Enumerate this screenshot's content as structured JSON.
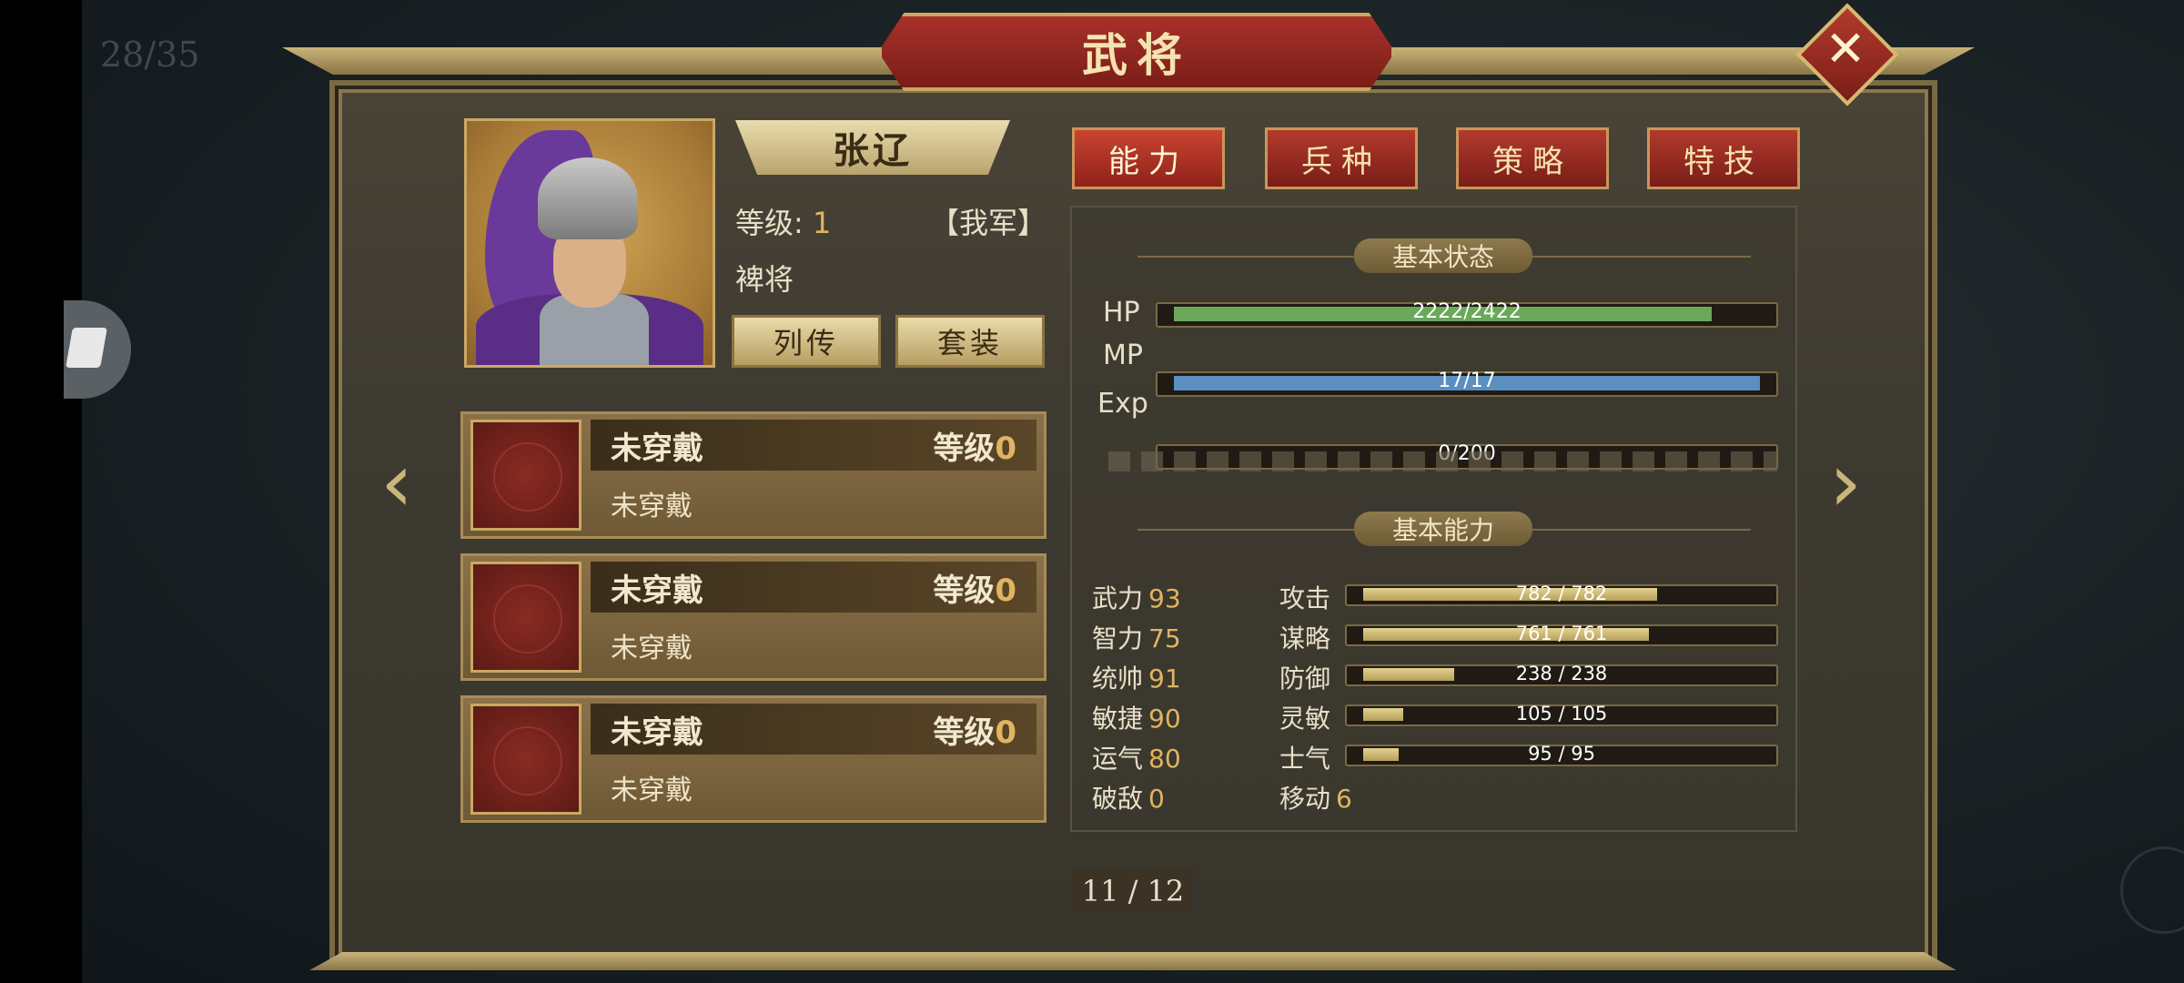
{
  "background": {
    "counter_text": "28/35"
  },
  "header": {
    "title": "武将",
    "close_icon": "close-icon"
  },
  "general": {
    "name": "张辽",
    "level_label": "等级:",
    "level_value": "1",
    "army": "【我军】",
    "rank": "裨将",
    "bio_button": "列传",
    "set_button": "套装"
  },
  "equipment": [
    {
      "name": "未穿戴",
      "level_label": "等级",
      "level_value": "0",
      "sub": "未穿戴"
    },
    {
      "name": "未穿戴",
      "level_label": "等级",
      "level_value": "0",
      "sub": "未穿戴"
    },
    {
      "name": "未穿戴",
      "level_label": "等级",
      "level_value": "0",
      "sub": "未穿戴"
    }
  ],
  "tabs": [
    "能力",
    "兵种",
    "策略",
    "特技"
  ],
  "status": {
    "section_title": "基本状态",
    "hp": {
      "label": "HP",
      "text": "2222/2422",
      "current": 2222,
      "max": 2422,
      "color": "#6aa85a"
    },
    "mp": {
      "label": "MP",
      "text": "17/17",
      "current": 17,
      "max": 17,
      "color": "#5a8fbf"
    },
    "exp": {
      "label": "Exp",
      "text": "0/200",
      "current": 0,
      "max": 200
    }
  },
  "ability": {
    "section_title": "基本能力",
    "base": [
      {
        "label": "武力",
        "value": "93"
      },
      {
        "label": "智力",
        "value": "75"
      },
      {
        "label": "统帅",
        "value": "91"
      },
      {
        "label": "敏捷",
        "value": "90"
      },
      {
        "label": "运气",
        "value": "80"
      },
      {
        "label": "破敌",
        "value": "0"
      }
    ],
    "derived": [
      {
        "label": "攻击",
        "text": "782 / 782",
        "fill": 0.74
      },
      {
        "label": "谋略",
        "text": "761 / 761",
        "fill": 0.72
      },
      {
        "label": "防御",
        "text": "238 / 238",
        "fill": 0.23
      },
      {
        "label": "灵敏",
        "text": "105 / 105",
        "fill": 0.1
      },
      {
        "label": "士气",
        "text": "95 / 95",
        "fill": 0.09
      }
    ],
    "move": {
      "label": "移动",
      "value": "6"
    }
  },
  "pagination": {
    "text": "11 / 12"
  }
}
